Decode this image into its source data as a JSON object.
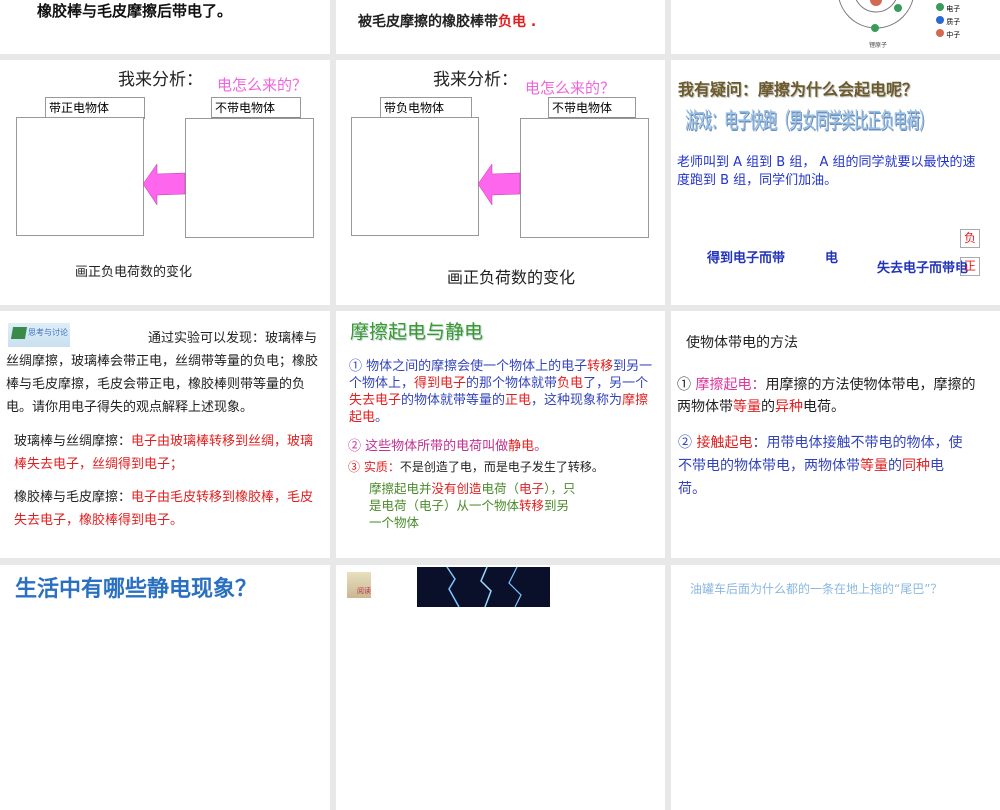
{
  "row1": {
    "s1": {
      "text": "橡胶棒与毛皮摩擦后带电了。"
    },
    "s2": {
      "segs": [
        {
          "t": "被毛皮摩擦的橡胶棒带",
          "c": "dark"
        },
        {
          "t": "负电",
          "c": "red"
        },
        {
          "t": " .",
          "c": "red"
        }
      ]
    },
    "s3": {
      "legend": [
        "电子",
        "质子",
        "中子"
      ],
      "atom_label": "锂原子",
      "colors": {
        "electron": "#3a9a5a",
        "proton": "#2a6ad0",
        "neutron": "#d06a50"
      }
    }
  },
  "row2": {
    "s1": {
      "title": "我来分析：",
      "question": "电怎么来的？",
      "left_label": "带正电物体",
      "right_label": "不带电物体",
      "caption": "画正负电荷数的变化"
    },
    "s2": {
      "title": "我来分析：",
      "question": "电怎么来的？",
      "left_label": "带负电物体",
      "right_label": "不带电物体",
      "caption": "画正负荷数的变化"
    },
    "s3": {
      "title": "我有疑问：摩擦为什么会起电呢？",
      "game": "游戏：电子快跑（男女同学类比正负电荷）",
      "body": "老师叫到 A 组到 B 组， A 组的同学就要以最快的速度跑到 B 组，同学们加油。",
      "gain": "得到电子而带",
      "gain_tail": "电",
      "lose": "失去电子而带电",
      "neg": "负",
      "pos": "正"
    }
  },
  "row3": {
    "s1": {
      "icon_label": "思考与讨论",
      "intro": "通过实验可以发现：玻璃棒与丝绸摩擦，玻璃棒会带正电，丝绸带等量的负电；橡胶棒与毛皮摩擦，毛皮会带正电，橡胶棒则带等量的负电。请你用电子得失的观点解释上述现象。",
      "a1": [
        {
          "t": "玻璃棒与丝绸摩擦：",
          "c": "dark"
        },
        {
          "t": "电子由玻璃棒转移到丝绸，玻璃棒失去电子，丝绸得到电子；",
          "c": "red"
        }
      ],
      "a2": [
        {
          "t": "橡胶棒与毛皮摩擦：",
          "c": "dark"
        },
        {
          "t": "电子由毛皮转移到橡胶棒，毛皮失去电子，橡胶棒得到电子。",
          "c": "red"
        }
      ]
    },
    "s2": {
      "title": "摩擦起电与静电",
      "p1": [
        {
          "t": "① 物体之间的摩擦会使一个物体上的电子",
          "c": "blue"
        },
        {
          "t": "转移",
          "c": "red"
        },
        {
          "t": "到另一个物体上，",
          "c": "blue"
        },
        {
          "t": "得到电子",
          "c": "red"
        },
        {
          "t": "的那个物体就带",
          "c": "blue"
        },
        {
          "t": "负电",
          "c": "red"
        },
        {
          "t": "了，另一个",
          "c": "blue"
        },
        {
          "t": "失去电子",
          "c": "red"
        },
        {
          "t": "的物体就带等量的",
          "c": "blue"
        },
        {
          "t": "正电",
          "c": "red"
        },
        {
          "t": "，这种现象称为",
          "c": "blue"
        },
        {
          "t": "摩擦起电",
          "c": "red"
        },
        {
          "t": "。",
          "c": "blue"
        }
      ],
      "p2": [
        {
          "t": "② 这些物体所带的电荷叫做",
          "c": "mag"
        },
        {
          "t": "静电",
          "c": "red"
        },
        {
          "t": "。",
          "c": "mag"
        }
      ],
      "p3": [
        {
          "t": "③ 实质：",
          "c": "red"
        },
        {
          "t": "不是创造了电，而是电子发生了转移。",
          "c": "dark"
        }
      ],
      "p4": [
        {
          "t": "摩擦起电并",
          "c": "green"
        },
        {
          "t": "没有创造",
          "c": "red"
        },
        {
          "t": "电荷（",
          "c": "green"
        },
        {
          "t": "电子",
          "c": "red"
        },
        {
          "t": "），只是电荷（电子）从一个物体",
          "c": "green"
        },
        {
          "t": "转移",
          "c": "red"
        },
        {
          "t": "到另一个物体",
          "c": "green"
        }
      ]
    },
    "s3": {
      "title": "使物体带电的方法",
      "p1": [
        {
          "t": "① ",
          "c": "dark"
        },
        {
          "t": "摩擦起电：",
          "c": "pink"
        },
        {
          "t": "用摩擦的方法使物体带电，摩擦的两物体带",
          "c": "dark"
        },
        {
          "t": "等量",
          "c": "red"
        },
        {
          "t": "的",
          "c": "dark"
        },
        {
          "t": "异种",
          "c": "red"
        },
        {
          "t": "电荷。",
          "c": "dark"
        }
      ],
      "p2": [
        {
          "t": "② ",
          "c": "blue"
        },
        {
          "t": "接触起电",
          "c": "red"
        },
        {
          "t": "：用带电体接触不带电的物体，使不带电的物体带电，两物体带",
          "c": "blue"
        },
        {
          "t": "等量",
          "c": "red"
        },
        {
          "t": "的",
          "c": "blue"
        },
        {
          "t": "同种",
          "c": "red"
        },
        {
          "t": "电荷。",
          "c": "blue"
        }
      ]
    }
  },
  "row4": {
    "s1": {
      "title": "生活中有哪些静电现象？"
    },
    "s2": {
      "icon_label": "阅读"
    },
    "s3": {
      "title": "油罐车后面为什么都的一条在地上拖的“尾巴”？"
    }
  }
}
